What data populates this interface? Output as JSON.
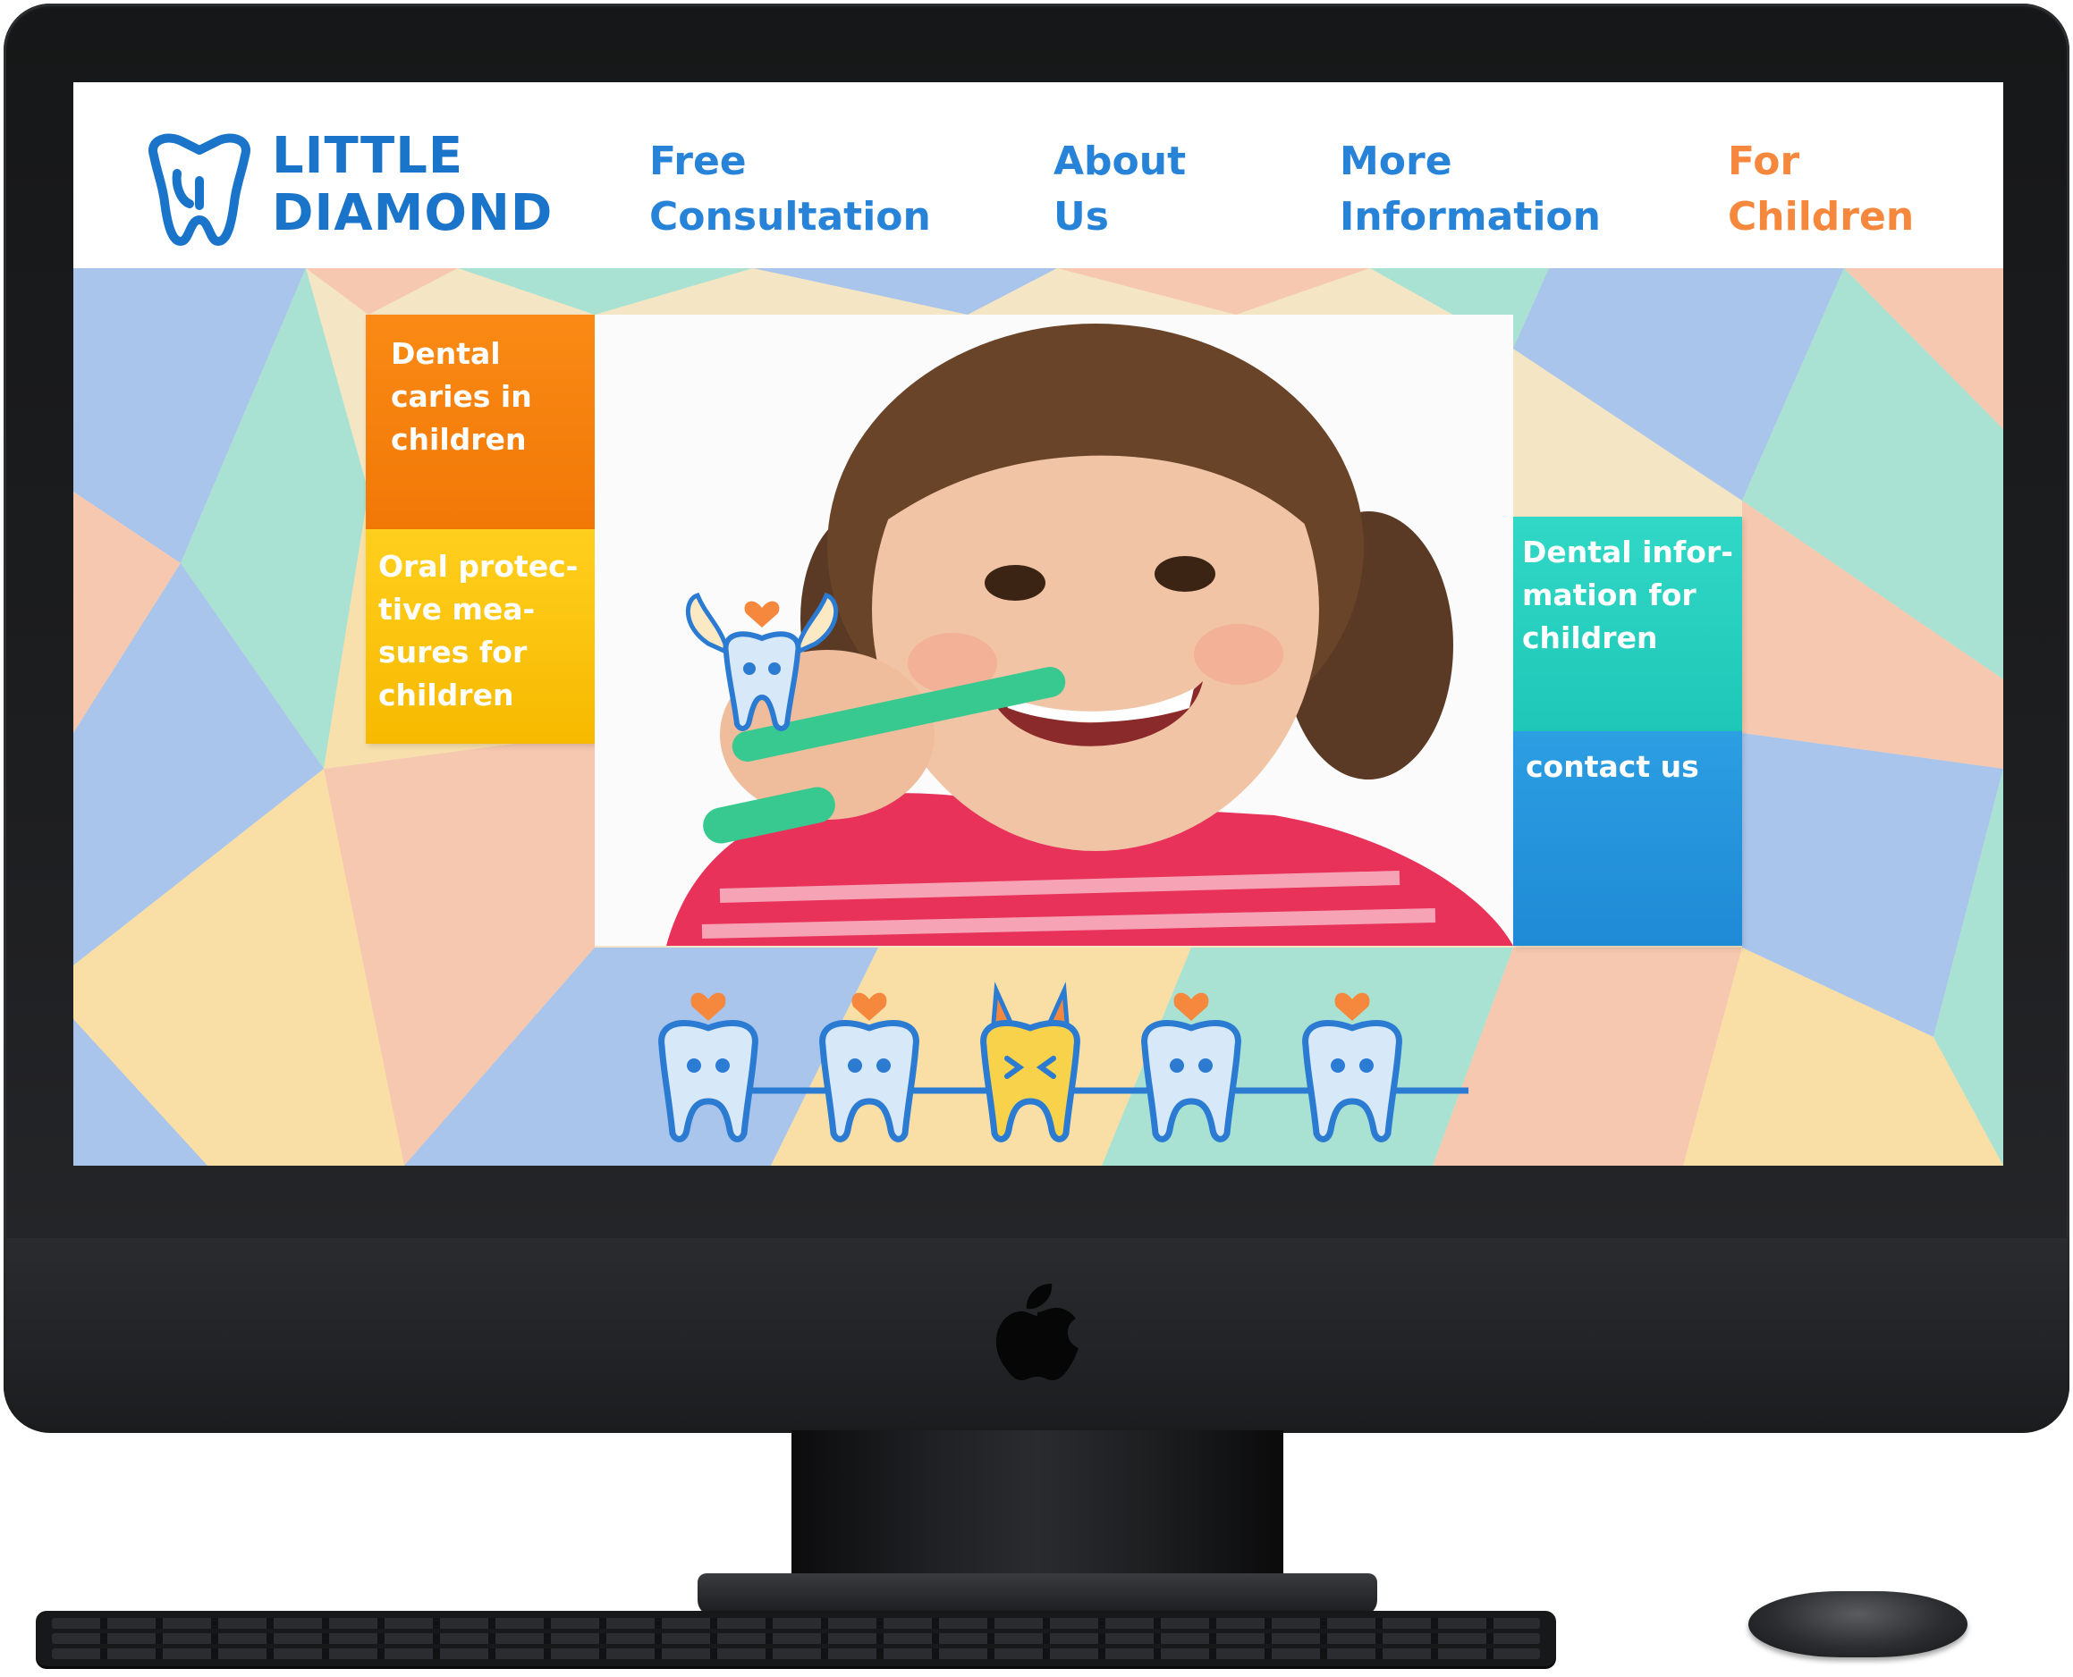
{
  "site": {
    "logo": {
      "line1": "LITTLE",
      "line2": "DIAMOND"
    },
    "nav": [
      {
        "line1": "Free",
        "line2": "Consultation"
      },
      {
        "line1": "About",
        "line2": "Us"
      },
      {
        "line1": "More",
        "line2": "Information"
      },
      {
        "line1": "For",
        "line2": "Children"
      }
    ],
    "tiles": {
      "caries": {
        "l1": "Dental",
        "l2": "caries in",
        "l3": "children"
      },
      "oral": {
        "l1": "Oral protec-",
        "l2": "tive mea-",
        "l3": "sures for",
        "l4": "children"
      },
      "info": {
        "l1": "Dental infor-",
        "l2": "mation for",
        "l3": "children"
      },
      "contact": {
        "l1": "contact us"
      }
    }
  },
  "colors": {
    "brand_blue": "#1a74c9",
    "nav_blue": "#2783d8",
    "nav_active_orange": "#f5883d",
    "tile_orange": "#f27806",
    "tile_yellow": "#f7b900",
    "tile_teal": "#1ec7b8",
    "tile_blue": "#1f8ad6"
  },
  "icons": {
    "logo": "tooth-icon",
    "device": "apple-logo-icon",
    "mascots": [
      "tooth-mascot-icon",
      "tooth-mascot-icon",
      "cavity-tooth-mascot-icon",
      "tooth-mascot-icon",
      "tooth-mascot-icon"
    ],
    "angel": "angel-tooth-mascot-icon"
  }
}
